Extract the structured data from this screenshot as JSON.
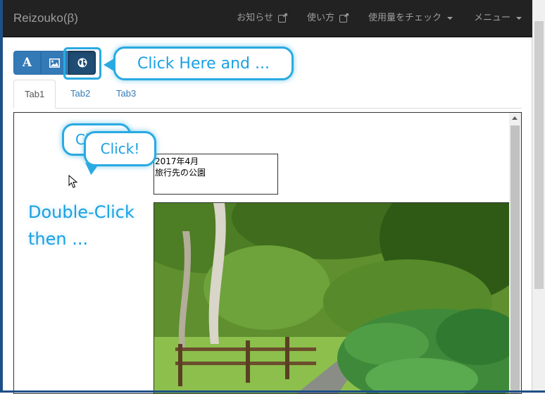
{
  "app": {
    "brand": "Reizouko(β)"
  },
  "nav": {
    "items": [
      {
        "label": "お知らせ",
        "icon": "external-link-icon"
      },
      {
        "label": "使い方",
        "icon": "external-link-icon"
      },
      {
        "label": "使用量をチェック",
        "icon": "caret-down-icon"
      },
      {
        "label": "メニュー",
        "icon": "caret-down-icon"
      }
    ]
  },
  "toolbar": {
    "text_button_glyph": "A",
    "buttons": [
      {
        "name": "text",
        "icon": "text-icon"
      },
      {
        "name": "image",
        "icon": "image-icon"
      },
      {
        "name": "web",
        "icon": "globe-icon",
        "active": true
      }
    ]
  },
  "annotations": {
    "top_bubble": "Click Here and ...",
    "click_bubble_back": "Cl",
    "click_bubble": "Click!",
    "double_click_line1": "Double-Click",
    "double_click_line2": "then ..."
  },
  "tabs": [
    {
      "label": "Tab1",
      "active": true
    },
    {
      "label": "Tab2",
      "active": false
    },
    {
      "label": "Tab3",
      "active": false
    }
  ],
  "note": {
    "text": "2017年4月\n旅行先の公園"
  },
  "colors": {
    "navbar_bg": "#222222",
    "primary": "#337ab7",
    "annotation": "#29aae1"
  }
}
